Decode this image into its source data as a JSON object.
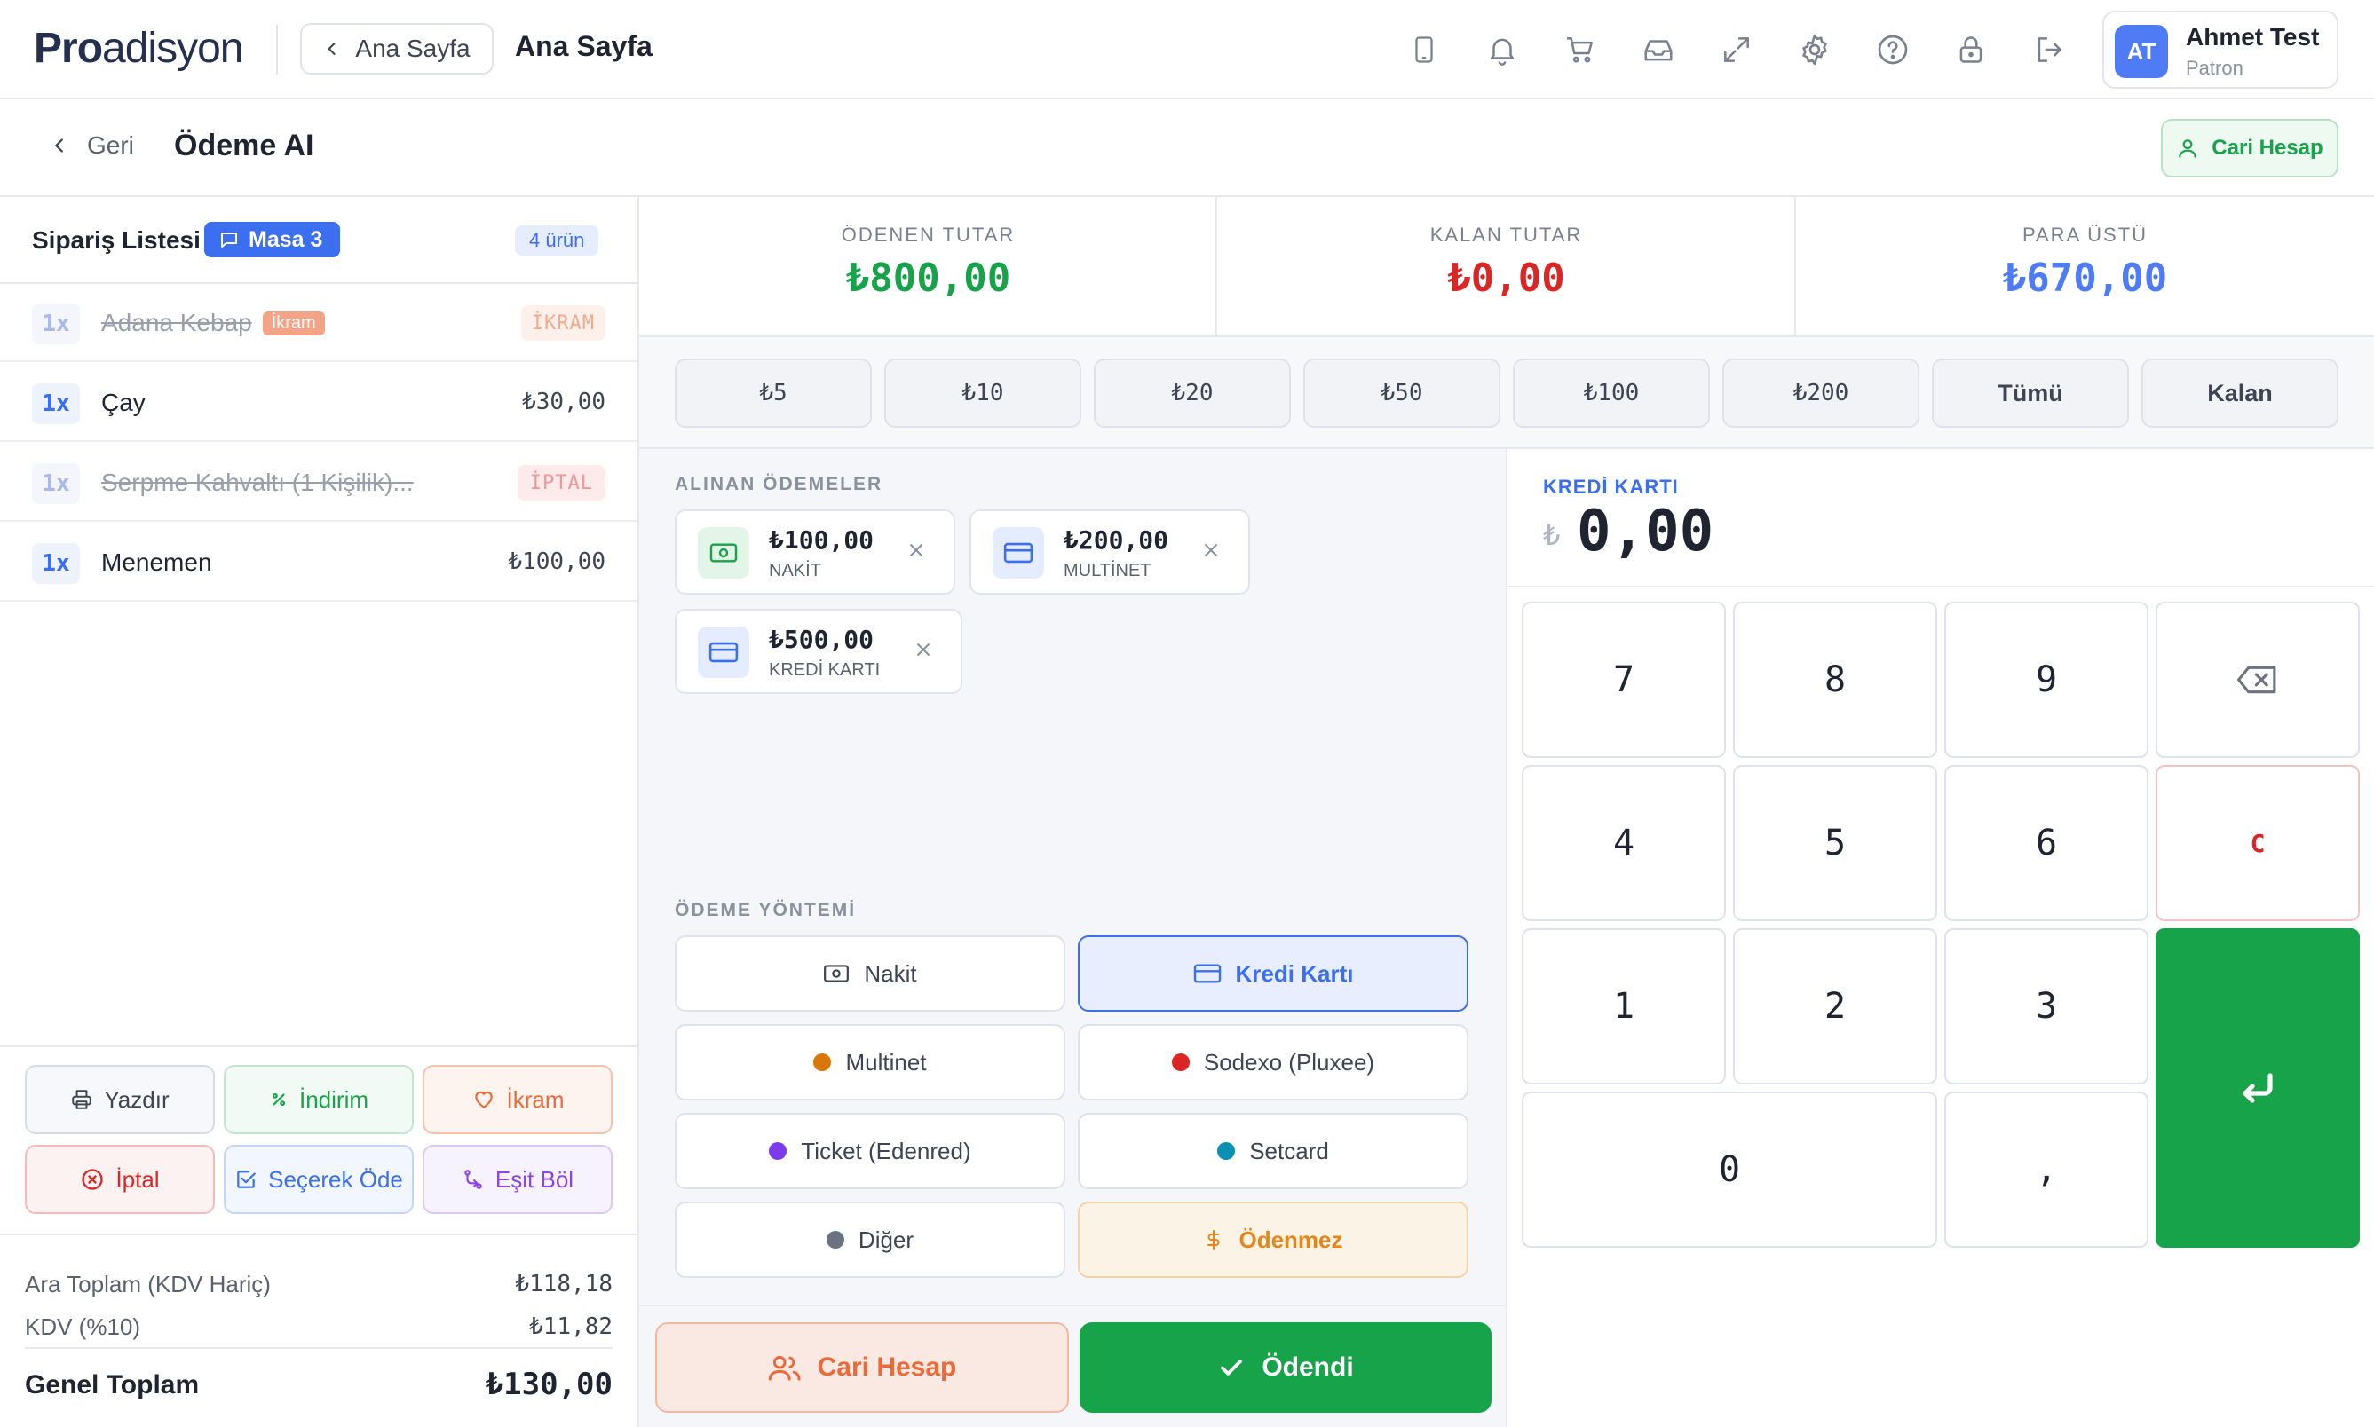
{
  "app": {
    "logo_pro": "Pro",
    "logo_rest": "adisyon"
  },
  "header": {
    "home_label": "Ana Sayfa",
    "title": "Ana Sayfa",
    "user": {
      "initials": "AT",
      "name": "Ahmet Test",
      "role": "Patron"
    },
    "icons": [
      "tablet-icon",
      "bell-icon",
      "cart-icon",
      "inbox-icon",
      "fullscreen-icon",
      "gear-icon",
      "help-icon",
      "lock-icon",
      "logout-icon"
    ]
  },
  "subheader": {
    "back_label": "Geri",
    "title": "Ödeme AI",
    "cari_label": "Cari Hesap"
  },
  "order": {
    "title": "Sipariş Listesi",
    "table_label": "Masa 3",
    "count_label": "4 ürün",
    "items": [
      {
        "qty": "1x",
        "name": "Adana Kebap",
        "tag": "İkram",
        "value": "İKRAM",
        "status": "ikram"
      },
      {
        "qty": "1x",
        "name": "Çay",
        "value": "₺30,00",
        "status": "normal"
      },
      {
        "qty": "1x",
        "name": "Serpme Kahvaltı (1 Kişilik)...",
        "value": "İPTAL",
        "status": "iptal"
      },
      {
        "qty": "1x",
        "name": "Menemen",
        "value": "₺100,00",
        "status": "normal"
      }
    ],
    "actions": {
      "print": "Yazdır",
      "discount": "İndirim",
      "ikram": "İkram",
      "cancel": "İptal",
      "select_pay": "Seçerek Öde",
      "split": "Eşit Böl"
    },
    "totals": {
      "subtotal_label": "Ara Toplam (KDV Hariç)",
      "subtotal": "₺118,18",
      "vat_label": "KDV (%10)",
      "vat": "₺11,82",
      "grand_label": "Genel Toplam",
      "grand": "₺130,00"
    }
  },
  "summary": {
    "paid_label": "ÖDENEN TUTAR",
    "paid": "₺800,00",
    "remaining_label": "KALAN TUTAR",
    "remaining": "₺0,00",
    "change_label": "PARA ÜSTÜ",
    "change": "₺670,00"
  },
  "quick_amounts": [
    "₺5",
    "₺10",
    "₺20",
    "₺50",
    "₺100",
    "₺200",
    "Tümü",
    "Kalan"
  ],
  "payments": {
    "title": "ALINAN ÖDEMELER",
    "items": [
      {
        "amount": "₺100,00",
        "label": "NAKİT"
      },
      {
        "amount": "₺200,00",
        "label": "MULTİNET"
      },
      {
        "amount": "₺500,00",
        "label": "KREDİ KARTI"
      }
    ]
  },
  "methods": {
    "title": "ÖDEME YÖNTEMİ",
    "items": [
      {
        "label": "Nakit"
      },
      {
        "label": "Kredi Kartı",
        "selected": true
      },
      {
        "label": "Multinet",
        "color": "#d97706"
      },
      {
        "label": "Sodexo (Pluxee)",
        "color": "#dc2626"
      },
      {
        "label": "Ticket (Edenred)",
        "color": "#7c3aed"
      },
      {
        "label": "Setcard",
        "color": "#0891b2"
      },
      {
        "label": "Diğer",
        "color": "#6b7280"
      },
      {
        "label": "Ödenmez"
      }
    ]
  },
  "bottom": {
    "cari_label": "Cari Hesap",
    "paid_label": "Ödendi"
  },
  "keypad": {
    "method_label": "KREDİ KARTI",
    "currency": "₺",
    "value": "0,00",
    "keys": [
      "7",
      "8",
      "9",
      "4",
      "5",
      "6",
      "C",
      "1",
      "2",
      "3",
      "0",
      ","
    ]
  },
  "colors": {
    "accent": "#3b6ff0",
    "success": "#16a34a",
    "danger": "#dc2626",
    "warning": "#ea6a3a"
  }
}
